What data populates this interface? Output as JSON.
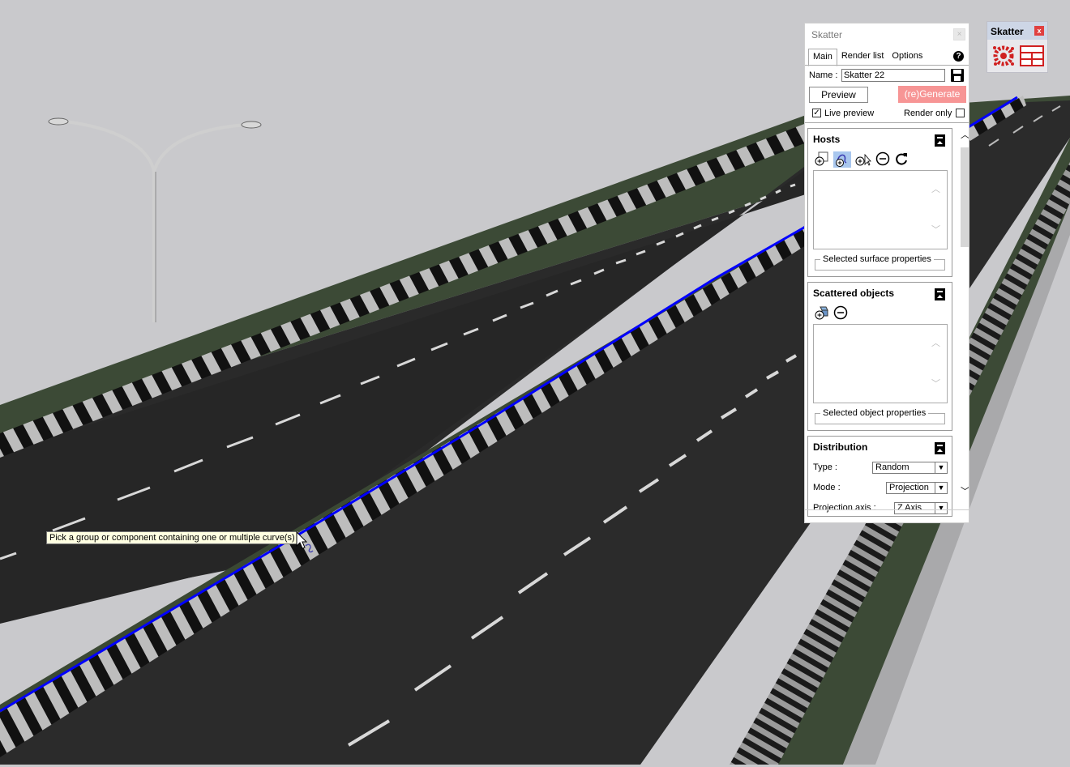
{
  "viewport": {
    "tooltip": "Pick a group or component containing one or multiple curve(s)"
  },
  "panel": {
    "title": "Skatter",
    "tabs": [
      "Main",
      "Render list",
      "Options"
    ],
    "active_tab": "Main",
    "name_label": "Name :",
    "name_value": "Skatter 22",
    "preview_button": "Preview",
    "generate_button": "(re)Generate",
    "live_preview_label": "Live preview",
    "live_preview_checked": true,
    "render_only_label": "Render only",
    "render_only_checked": false,
    "hosts": {
      "title": "Hosts",
      "properties_label": "Selected surface properties"
    },
    "scattered": {
      "title": "Scattered objects",
      "properties_label": "Selected object properties"
    },
    "distribution": {
      "title": "Distribution",
      "type_label": "Type :",
      "type_value": "Random",
      "mode_label": "Mode :",
      "mode_value": "Projection",
      "projection_axis_label": "Projection axis :",
      "projection_axis_value": "Z Axis"
    }
  },
  "toolbar": {
    "title": "Skatter",
    "close_label": "x"
  },
  "colors": {
    "accent_generate": "#f79595",
    "curve_highlight": "#0000ff",
    "asphalt": "#2a2a2a",
    "grass": "#3b4a34"
  }
}
